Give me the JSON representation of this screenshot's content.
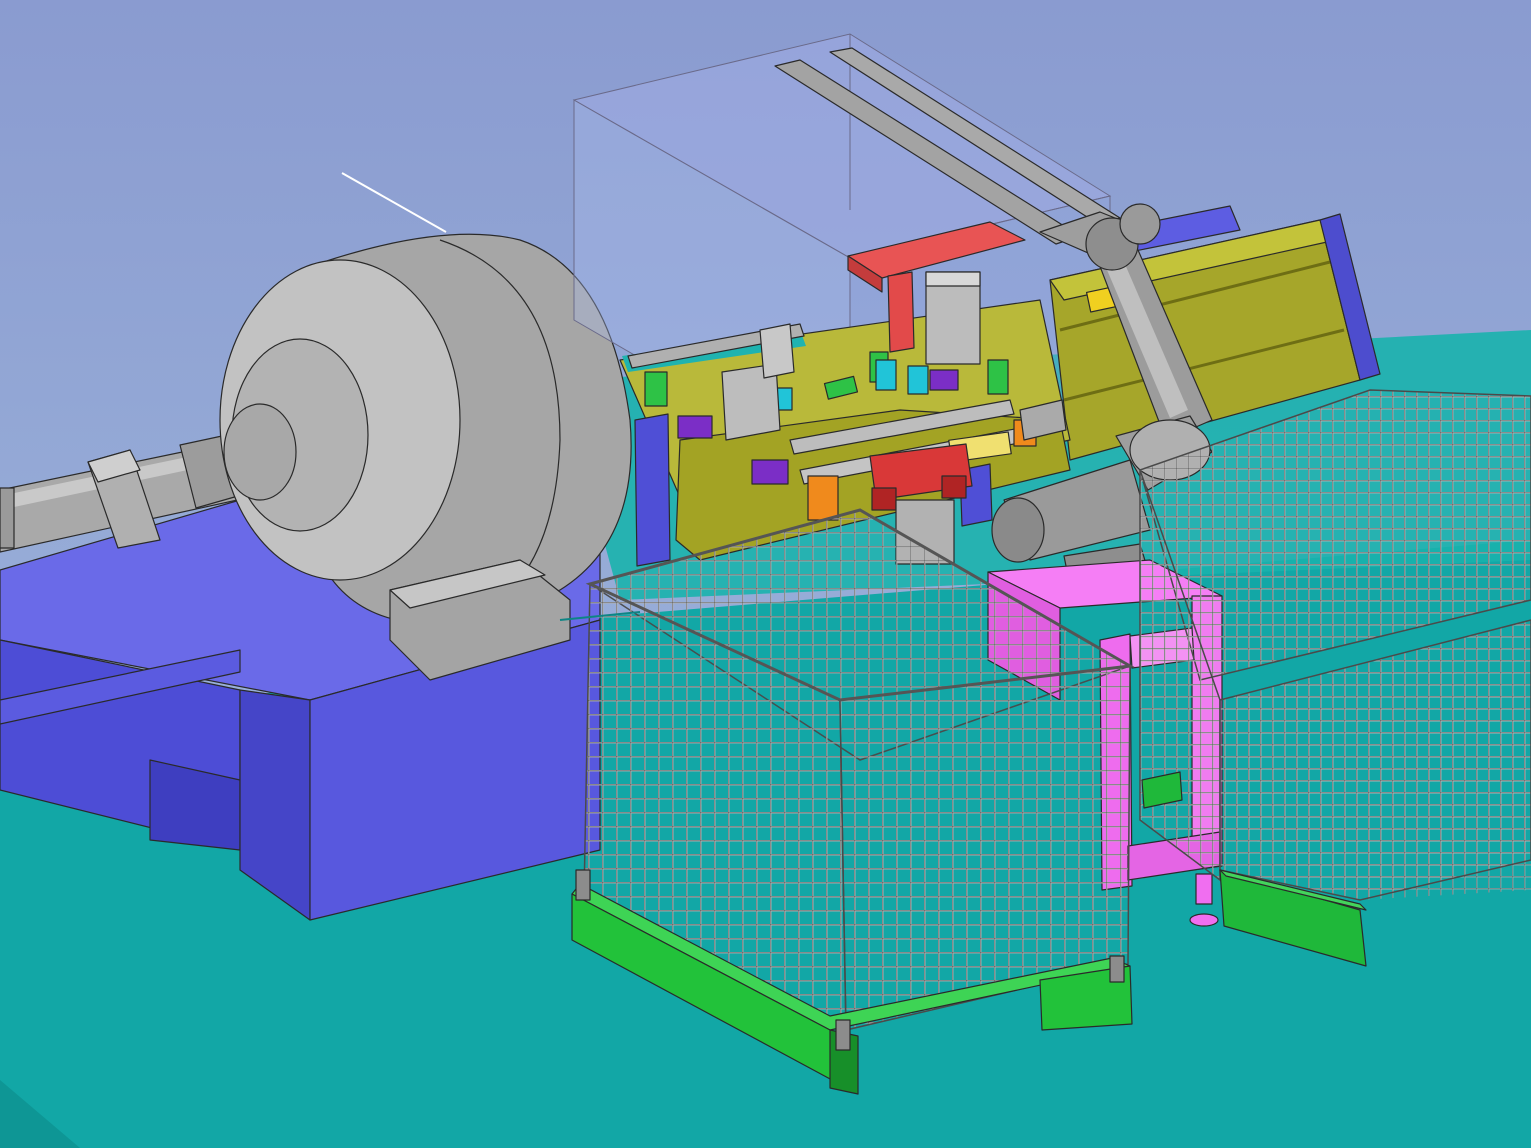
{
  "scene": {
    "colors": {
      "sky_top": "#8ea0d2",
      "sky_bottom": "#9cb6dc",
      "floor": "#12a7a6",
      "floor_shadow": "#0e8f8e",
      "base_blue": "#5a5ae0",
      "base_blue_dark": "#3d3db0",
      "steel_grey": "#b4b4b4",
      "steel_dark": "#8c8c8c",
      "rail_olive": "#a8a830",
      "rail_olive_dark": "#7e7e1a",
      "pallet_green": "#22c23a",
      "pallet_green_dark": "#168a26",
      "robot_pedestal": "#f06ef0",
      "gripper_red": "#e84848",
      "enclosure_glass": "rgba(170,185,230,0.45)",
      "accent_purple": "#7a2bc4",
      "accent_orange": "#f08a1c",
      "accent_yellow": "#f0d020"
    },
    "icons": {
      "spindle": "lathe-chuck-icon",
      "robot": "robot-arm-icon",
      "cage": "wire-basket-icon",
      "gantry": "linear-rail-icon"
    }
  }
}
